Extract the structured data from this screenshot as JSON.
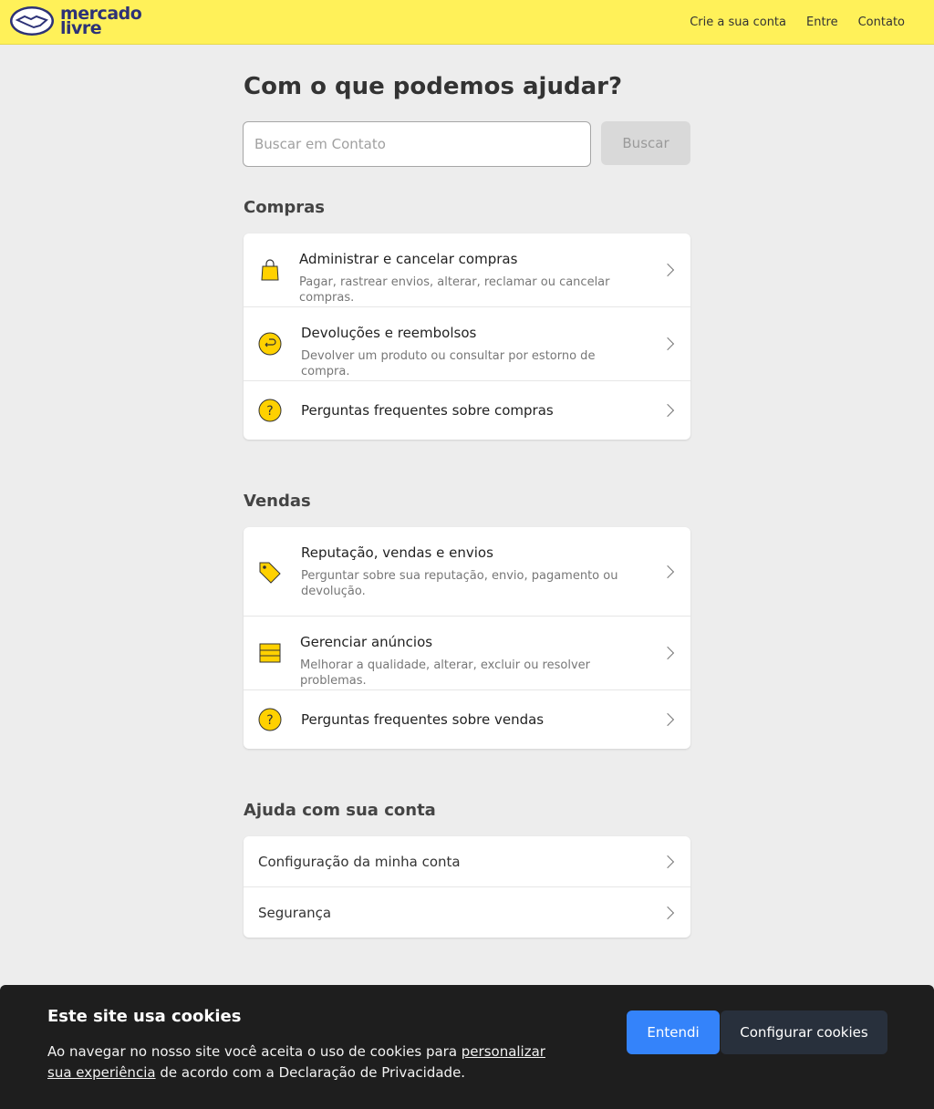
{
  "header": {
    "logo_line1": "mercado",
    "logo_line2": "livre",
    "nav": [
      "Crie a sua conta",
      "Entre",
      "Contato"
    ]
  },
  "page_title": "Com o que podemos ajudar?",
  "search": {
    "placeholder": "Buscar em Contato",
    "button": "Buscar"
  },
  "sections": {
    "compras": {
      "title": "Compras",
      "items": [
        {
          "title": "Administrar e cancelar compras",
          "subtitle": "Pagar, rastrear envios, alterar, reclamar ou cancelar compras.",
          "icon": "shopping-bag-icon"
        },
        {
          "title": "Devoluções e reembolsos",
          "subtitle": "Devolver um produto ou consultar por estorno de compra.",
          "icon": "return-icon"
        },
        {
          "title": "Perguntas frequentes sobre compras",
          "icon": "question-icon"
        }
      ]
    },
    "vendas": {
      "title": "Vendas",
      "items": [
        {
          "title": "Reputação, vendas e envios",
          "subtitle": "Perguntar sobre sua reputação, envio, pagamento ou devolução.",
          "icon": "tag-icon"
        },
        {
          "title": "Gerenciar anúncios",
          "subtitle": "Melhorar a qualidade, alterar, excluir ou resolver problemas.",
          "icon": "listings-icon"
        },
        {
          "title": "Perguntas frequentes sobre vendas",
          "icon": "question-icon"
        }
      ]
    },
    "conta": {
      "title": "Ajuda com sua conta",
      "items": [
        {
          "title": "Configuração da minha conta"
        },
        {
          "title": "Segurança"
        }
      ]
    }
  },
  "cookie": {
    "title": "Este site usa cookies",
    "text_before": "Ao navegar no nosso site você aceita o uso de cookies para ",
    "link": "personalizar sua experiência",
    "text_after": " de acordo com a Declaração de Privacidade.",
    "accept": "Entendi",
    "configure": "Configurar cookies"
  },
  "colors": {
    "header": "#fff159",
    "accent": "#3483fa",
    "icon_yellow": "#ffd100"
  }
}
